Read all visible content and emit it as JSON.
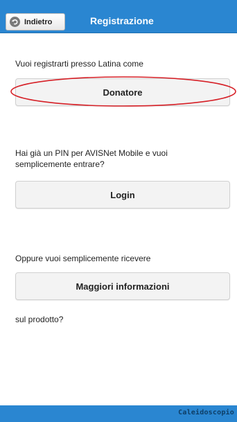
{
  "header": {
    "back_label": "Indietro",
    "title": "Registrazione"
  },
  "sections": {
    "register_prompt": "Vuoi registrarti presso Latina come",
    "donor_button": "Donatore",
    "pin_prompt": "Hai già un PIN per AVISNet Mobile e vuoi semplicemente entrare?",
    "login_button": "Login",
    "info_prompt": "Oppure vuoi semplicemente ricevere",
    "info_button": "Maggiori informazioni",
    "info_suffix": "sul prodotto?"
  },
  "footer": {
    "brand": "Caleidoscopio"
  },
  "colors": {
    "bar": "#2a86d1",
    "annotation": "#d61f26"
  }
}
